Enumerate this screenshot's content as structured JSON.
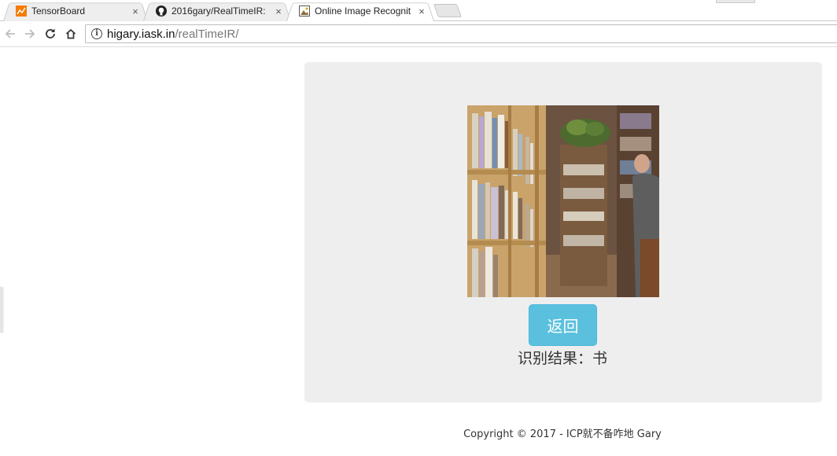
{
  "browser": {
    "tabs": [
      {
        "title": "TensorBoard",
        "icon": "tensorboard-icon",
        "active": false
      },
      {
        "title": "2016gary/RealTimeIR:",
        "icon": "github-icon",
        "active": false
      },
      {
        "title": "Online Image Recognit",
        "icon": "image-icon",
        "active": true
      }
    ],
    "close_glyph": "×",
    "url_host": "higary.iask.in",
    "url_path": "/realTimeIR/",
    "info_glyph": "i"
  },
  "page": {
    "back_button_label": "返回",
    "result_text": "识别结果：书",
    "footer_text": "Copyright © 2017 - ICP就不备咋地 Gary"
  },
  "colors": {
    "panel_bg": "#eeeeee",
    "button_bg": "#5bc0de",
    "tensorboard_orange": "#f57c00"
  }
}
